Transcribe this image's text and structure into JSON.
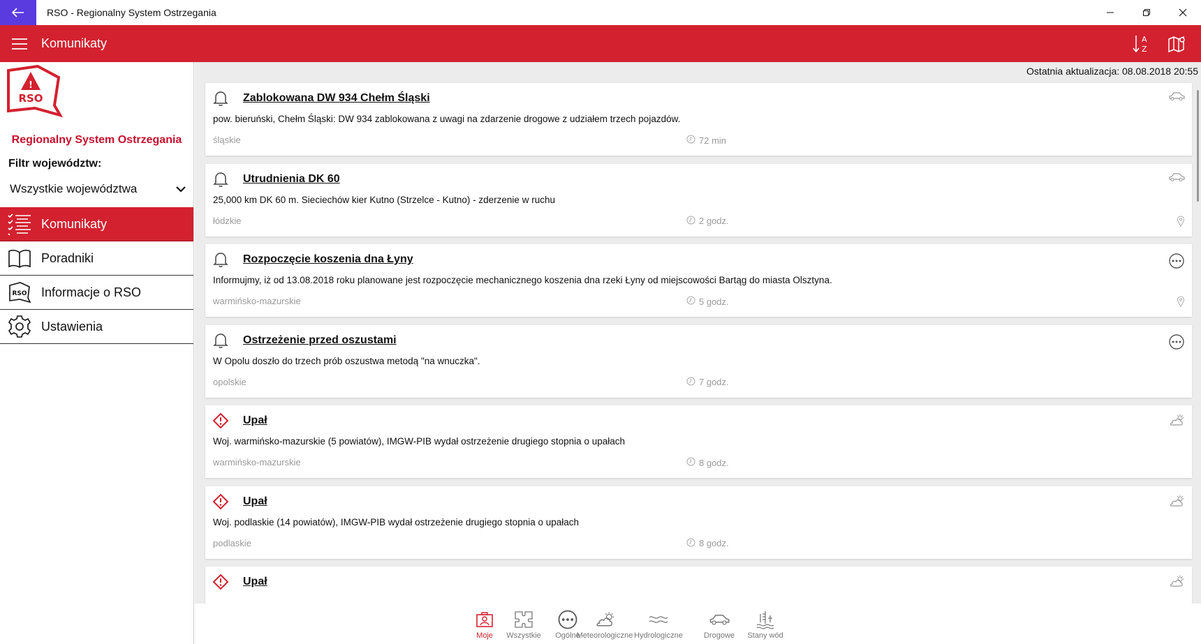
{
  "window": {
    "title": "RSO - Regionalny System Ostrzegania"
  },
  "appbar": {
    "title": "Komunikaty",
    "sort_icon": "sort-az-icon",
    "map_icon": "map-icon"
  },
  "sidebar": {
    "brand": "Regionalny System Ostrzegania",
    "filter_label": "Filtr województw:",
    "filter_value": "Wszystkie województwa",
    "items": [
      {
        "label": "Komunikaty",
        "icon": "list-check-icon",
        "active": true
      },
      {
        "label": "Poradniki",
        "icon": "book-icon",
        "active": false
      },
      {
        "label": "Informacje o RSO",
        "icon": "rso-badge-icon",
        "active": false
      },
      {
        "label": "Ustawienia",
        "icon": "gear-icon",
        "active": false
      }
    ]
  },
  "content": {
    "last_update": "Ostatnia aktualizacja: 08.08.2018 20:55"
  },
  "cards": [
    {
      "icon": "bell-icon",
      "title": "Zablokowana DW 934 Chełm Śląski",
      "desc": "pow. bieruński, Chełm Śląski: DW 934 zablokowana z uwagi na zdarzenie drogowe z udziałem trzech pojazdów.",
      "region": "śląskie",
      "time": "72 min",
      "category": "car-icon",
      "pin": false
    },
    {
      "icon": "bell-icon",
      "title": "Utrudnienia DK 60",
      "desc": "25,000 km DK 60 m. Sieciechów  kier Kutno (Strzelce - Kutno) - zderzenie w ruchu",
      "region": "łódzkie",
      "time": "2 godz.",
      "category": "car-icon",
      "pin": true
    },
    {
      "icon": "bell-icon",
      "title": "Rozpoczęcie koszenia dna Łyny",
      "desc": "Informujmy, iż od 13.08.2018 roku planowane jest rozpoczęcie mechanicznego koszenia dna rzeki Łyny od miejscowości Bartąg do miasta Olsztyna.",
      "region": "warmińsko-mazurskie",
      "time": "5 godz.",
      "category": "more-icon",
      "pin": true
    },
    {
      "icon": "bell-icon",
      "title": "Ostrzeżenie przed oszustami",
      "desc": "W Opolu doszło do trzech prób oszustwa metodą \"na wnuczka\".",
      "region": "opolskie",
      "time": "7 godz.",
      "category": "more-icon",
      "pin": false
    },
    {
      "icon": "warning-icon",
      "title": "Upał",
      "desc": "Woj. warmińsko-mazurskie (5 powiatów), IMGW-PIB wydał ostrzeżenie drugiego stopnia o upałach",
      "region": "warmińsko-mazurskie",
      "time": "8 godz.",
      "category": "weather-icon",
      "pin": false
    },
    {
      "icon": "warning-icon",
      "title": "Upał",
      "desc": "Woj. podlaskie (14 powiatów), IMGW-PIB wydał ostrzeżenie drugiego stopnia o upałach",
      "region": "podlaskie",
      "time": "8 godz.",
      "category": "weather-icon",
      "pin": false
    },
    {
      "icon": "warning-icon",
      "title": "Upał",
      "desc": "",
      "region": "",
      "time": "",
      "category": "weather-icon",
      "pin": false
    }
  ],
  "bottom_tabs": [
    {
      "label": "Moje",
      "icon": "user-card-icon",
      "active": true
    },
    {
      "label": "Wszystkie",
      "icon": "puzzle-icon",
      "active": false
    },
    {
      "label": "Ogólne",
      "icon": "more-icon",
      "active": false
    },
    {
      "label": "Meteorologiczne",
      "icon": "weather-icon",
      "active": false
    },
    {
      "label": "Hydrologiczne",
      "icon": "waves-icon",
      "active": false
    },
    {
      "label": "Drogowe",
      "icon": "car-icon",
      "active": false
    },
    {
      "label": "Stany wód",
      "icon": "water-level-icon",
      "active": false
    }
  ]
}
